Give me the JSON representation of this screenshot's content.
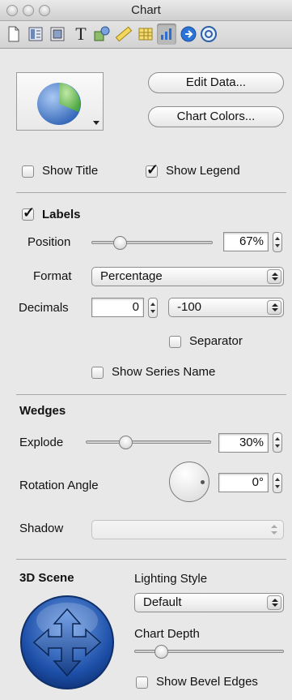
{
  "window": {
    "title": "Chart"
  },
  "toolbar": {
    "items": [
      {
        "name": "document-icon"
      },
      {
        "name": "layout-icon"
      },
      {
        "name": "wrap-icon"
      },
      {
        "name": "text-icon",
        "glyph": "T"
      },
      {
        "name": "graphic-icon"
      },
      {
        "name": "metrics-icon"
      },
      {
        "name": "table-icon"
      },
      {
        "name": "chart-icon",
        "selected": true
      },
      {
        "name": "link-icon"
      },
      {
        "name": "quicktime-icon"
      }
    ]
  },
  "chart_type": {
    "icon": "pie-chart-icon"
  },
  "buttons": {
    "edit_data": "Edit Data...",
    "chart_colors": "Chart Colors..."
  },
  "options": {
    "show_title": "Show Title",
    "show_title_checked": false,
    "show_legend": "Show Legend",
    "show_legend_checked": true
  },
  "labels": {
    "heading": "Labels",
    "checked": true,
    "position_label": "Position",
    "position_value": "67%",
    "position_level": 0.2,
    "format_label": "Format",
    "format_value": "Percentage",
    "decimals_label": "Decimals",
    "decimals_value": "0",
    "negative_format": "-100",
    "separator": "Separator",
    "separator_checked": false,
    "show_series_name": "Show Series Name",
    "show_series_name_checked": false
  },
  "wedges": {
    "heading": "Wedges",
    "explode_label": "Explode",
    "explode_value": "30%",
    "explode_level": 0.3,
    "rotation_label": "Rotation Angle",
    "rotation_value": "0°",
    "shadow_label": "Shadow",
    "shadow_value": ""
  },
  "scene": {
    "heading": "3D Scene",
    "lighting_label": "Lighting Style",
    "lighting_value": "Default",
    "depth_label": "Chart Depth",
    "depth_level": 0.15,
    "bevel_label": "Show Bevel Edges",
    "bevel_checked": false
  },
  "colors": {
    "accent_blue": "#2a5fb4",
    "pie_green": "#5cbf5c"
  }
}
